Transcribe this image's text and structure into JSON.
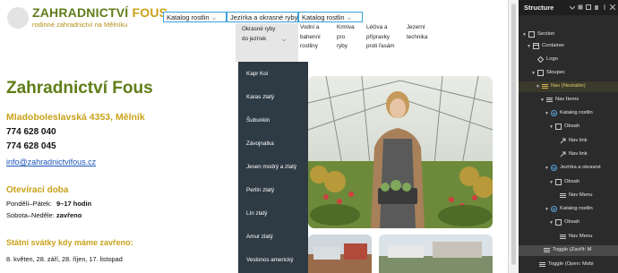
{
  "header": {
    "brand_main": "ZAHRADNICTVÍ",
    "brand_accent": "FOUS",
    "tagline": "rodinné zahradnictví na Mělníku"
  },
  "nav": {
    "items": [
      {
        "label": "Katalog rostlin",
        "icon": "chevron-down-icon"
      },
      {
        "label": "Jezírka a okrasné ryby",
        "icon": "chevron-down-icon"
      },
      {
        "label": "Katalog rostlin",
        "icon": "chevron-down-icon"
      }
    ],
    "mega_columns": [
      "Okrasné ryby do jezírek",
      "Vodní a bahenní rostliny",
      "Krmiva pro ryby",
      "Léčiva a přípravky proti řasám",
      "Jezerní technika"
    ],
    "dropdown_items": [
      "Kapr Koi",
      "Karas zlatý",
      "Šubunkin",
      "Závojnatka",
      "Jesen modrý a zlatý",
      "Perlín zlatý",
      "Lín zlatý",
      "Amur zlatý",
      "Veslonos americký"
    ]
  },
  "main": {
    "title": "Zahradnictví Fous",
    "address": "Mladoboleslavská 4353, Mělník",
    "phones": [
      "774 628 040",
      "774 628 045"
    ],
    "email": "info@zahradnictvifous.cz",
    "hours_heading": "Otevírací doba",
    "hours": [
      {
        "day": "Pondělí–Pátek:",
        "value": "9–17 hodin"
      },
      {
        "day": "Sobota–Neděle:",
        "value": "zavřeno"
      }
    ],
    "holidays_heading": "Státní svátky kdy máme zavřeno:",
    "holiday_dates": "8. květen, 28. září, 28. říjen, 17. listopad"
  },
  "structure_panel": {
    "title": "Structure",
    "tree": [
      {
        "label": "Section",
        "icon": "section-icon",
        "depth": 0
      },
      {
        "label": "Container",
        "icon": "container-icon",
        "depth": 1
      },
      {
        "label": "Logo",
        "icon": "logo-icon",
        "depth": 2
      },
      {
        "label": "Sloupec",
        "icon": "block-icon",
        "depth": 2
      },
      {
        "label": "Nav (Nestable)",
        "icon": "nav-icon",
        "depth": 3
      },
      {
        "label": "Nav Items",
        "icon": "list-icon",
        "depth": 4
      },
      {
        "label": "Katalog rostlin",
        "icon": "dropdown-icon",
        "depth": 5
      },
      {
        "label": "Obsah",
        "icon": "block-icon",
        "depth": 6
      },
      {
        "label": "Nav link",
        "icon": "link-icon",
        "depth": 7
      },
      {
        "label": "Nav link",
        "icon": "link-icon",
        "depth": 7
      },
      {
        "label": "Jezírka a okrasné",
        "icon": "dropdown-icon",
        "depth": 5
      },
      {
        "label": "Obsah",
        "icon": "block-icon",
        "depth": 6
      },
      {
        "label": "Nav Menu",
        "icon": "menu-icon",
        "depth": 7
      },
      {
        "label": "Katalog rostlin",
        "icon": "dropdown-icon",
        "depth": 5
      },
      {
        "label": "Obsah",
        "icon": "block-icon",
        "depth": 6
      },
      {
        "label": "Nav Menu",
        "icon": "menu-icon",
        "depth": 7
      },
      {
        "label": "Toggle (Zavřít: M",
        "icon": "toggle-icon",
        "depth": 5
      },
      {
        "label": "Toggle (Open: Mobi",
        "icon": "toggle-icon",
        "depth": 4
      }
    ]
  },
  "colors": {
    "brand_green": "#5f7d18",
    "brand_gold": "#c9a21a",
    "dropdown_bg": "#2e3a44",
    "panel_bg": "#2b2b2b",
    "selection_outline": "#3aa0d8"
  }
}
